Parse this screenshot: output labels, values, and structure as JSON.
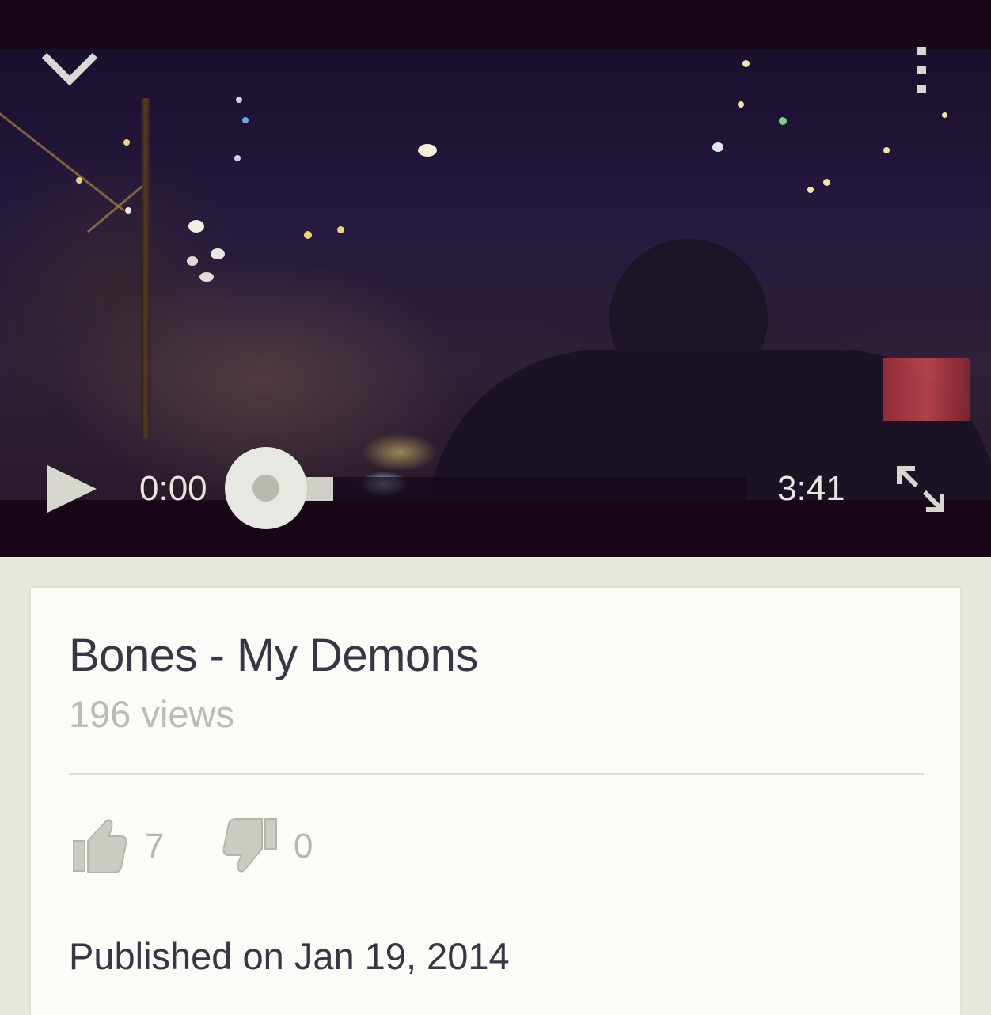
{
  "player": {
    "current_time": "0:00",
    "duration": "3:41",
    "progress": 0.0,
    "buffered": 0.14
  },
  "video": {
    "title": "Bones - My Demons",
    "views": "196 views",
    "likes": "7",
    "dislikes": "0",
    "published": "Published on Jan 19, 2014"
  },
  "icons": {
    "collapse": "chevron-down-icon",
    "menu": "more-vert-icon",
    "play": "play-icon",
    "fullscreen": "fullscreen-icon",
    "like": "thumbs-up-icon",
    "dislike": "thumbs-down-icon"
  },
  "colors": {
    "player_bg": "#190718",
    "card_bg": "#fbfcf7",
    "page_bg": "#e4e8dd",
    "title_text": "#3a3544",
    "muted_text": "#b9bcb3"
  }
}
